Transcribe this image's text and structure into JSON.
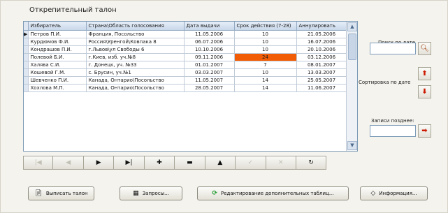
{
  "panel": {
    "title": "Открепительный талон"
  },
  "grid": {
    "columns": [
      "Избиратель",
      "Страна\\Область голосования",
      "Дата выдачи",
      "Срок действия (7-28)",
      "Аннулировать"
    ],
    "rows": [
      [
        "Петров П.И.",
        "Франция, Посольство",
        "11.05.2006",
        "10",
        "21.05.2006"
      ],
      [
        "Курдюмов Ф.И.",
        "Россия\\Уренгой\\Ковпака 8",
        "06.07.2006",
        "10",
        "16.07.2006"
      ],
      [
        "Кондрашов П.И.",
        "г.Львов\\ул Свободы 6",
        "10.10.2006",
        "10",
        "20.10.2006"
      ],
      [
        "Полевой Б.И.",
        "г.Киев, изб. уч.№8",
        "09.11.2006",
        "24",
        "03.12.2006"
      ],
      [
        "Халява С.И.",
        "г. Донецк, уч. №33",
        "01.01.2007",
        "7",
        "08.01.2007"
      ],
      [
        "Кошевой Г.М.",
        "с. Брусин, уч.№1",
        "03.03.2007",
        "10",
        "13.03.2007"
      ],
      [
        "Шевченко П.И.",
        "Канада, Онтарио\\Посольство",
        "11.05.2007",
        "14",
        "25.05.2007"
      ],
      [
        "Хохлова М.П.",
        "Канада, Онтарио\\Посольство",
        "28.05.2007",
        "14",
        "11.06.2007"
      ]
    ],
    "highlight_color": "#f25c05"
  },
  "nav_buttons": [
    {
      "name": "first-record-button",
      "glyph": "|◀",
      "enabled": false
    },
    {
      "name": "prior-record-button",
      "glyph": "◀",
      "enabled": false
    },
    {
      "name": "next-record-button",
      "glyph": "▶",
      "enabled": true
    },
    {
      "name": "last-record-button",
      "glyph": "▶|",
      "enabled": true
    },
    {
      "name": "insert-record-button",
      "glyph": "✚",
      "enabled": true
    },
    {
      "name": "delete-record-button",
      "glyph": "▬",
      "enabled": true
    },
    {
      "name": "edit-record-button",
      "glyph": "▲",
      "enabled": true
    },
    {
      "name": "post-record-button",
      "glyph": "✓",
      "enabled": false
    },
    {
      "name": "cancel-record-button",
      "glyph": "✕",
      "enabled": false
    },
    {
      "name": "refresh-button",
      "glyph": "↻",
      "enabled": true
    }
  ],
  "side": {
    "search_label": "Поиск по дате",
    "search_value": "",
    "sort_label": "Сортировка по дате",
    "later_label": "Записи позднее:",
    "later_value": ""
  },
  "buttons": {
    "issue": "Выписать талон",
    "queries": "Запросы...",
    "edit_tables": "Редактирование дополнительных таблиц...",
    "info": "Информация..."
  }
}
